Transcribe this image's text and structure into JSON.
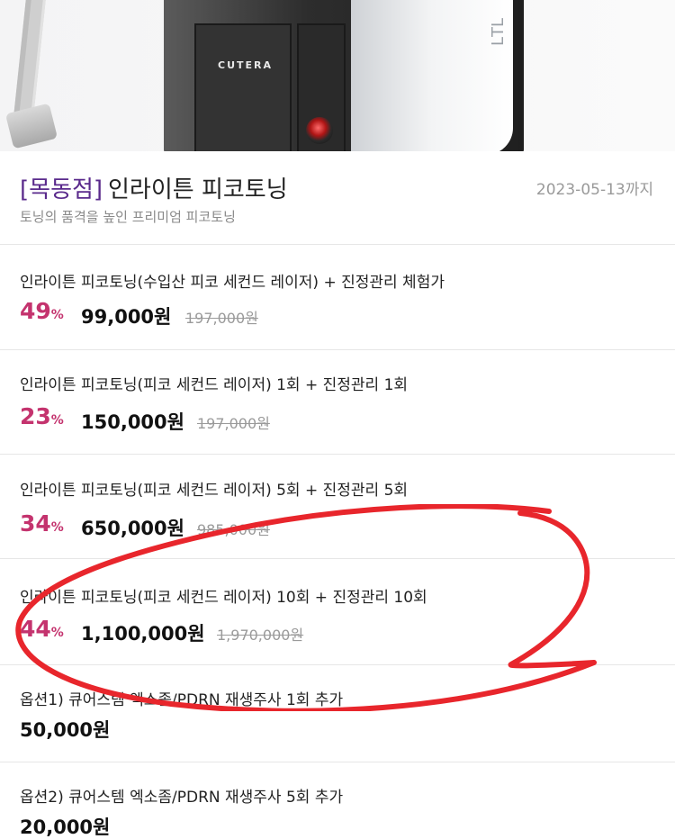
{
  "hero": {
    "brand": "CUTERA",
    "side_glyph": "ꓶꓕꓶ"
  },
  "header": {
    "branch": "[목동점]",
    "title": "인라이튼 피코토닝",
    "deadline": "2023-05-13까지",
    "subtitle": "토닝의 품격을 높인 프리미엄 피코토닝"
  },
  "items": [
    {
      "name": "인라이튼 피코토닝(수입산 피코 세컨드 레이저) + 진정관리 체험가",
      "discount": "49",
      "percent": "%",
      "price": "99,000원",
      "original": "197,000원"
    },
    {
      "name": "인라이튼 피코토닝(피코 세컨드 레이저) 1회 + 진정관리 1회",
      "discount": "23",
      "percent": "%",
      "price": "150,000원",
      "original": "197,000원"
    },
    {
      "name": "인라이튼 피코토닝(피코 세컨드 레이저) 5회 + 진정관리 5회",
      "discount": "34",
      "percent": "%",
      "price": "650,000원",
      "original": "985,000원"
    },
    {
      "name": "인라이튼 피코토닝(피코 세컨드 레이저) 10회 + 진정관리 10회",
      "discount": "44",
      "percent": "%",
      "price": "1,100,000원",
      "original": "1,970,000원"
    }
  ],
  "options": [
    {
      "name": "옵션1) 큐어스템 엑소좀/PDRN 재생주사 1회 추가",
      "price": "50,000원"
    },
    {
      "name": "옵션2) 큐어스템 엑소좀/PDRN 재생주사 5회 추가",
      "price": "20,000원"
    }
  ],
  "colors": {
    "discount": "#c4336e",
    "branch": "#5a2a8c",
    "annotation": "#e8262c"
  }
}
